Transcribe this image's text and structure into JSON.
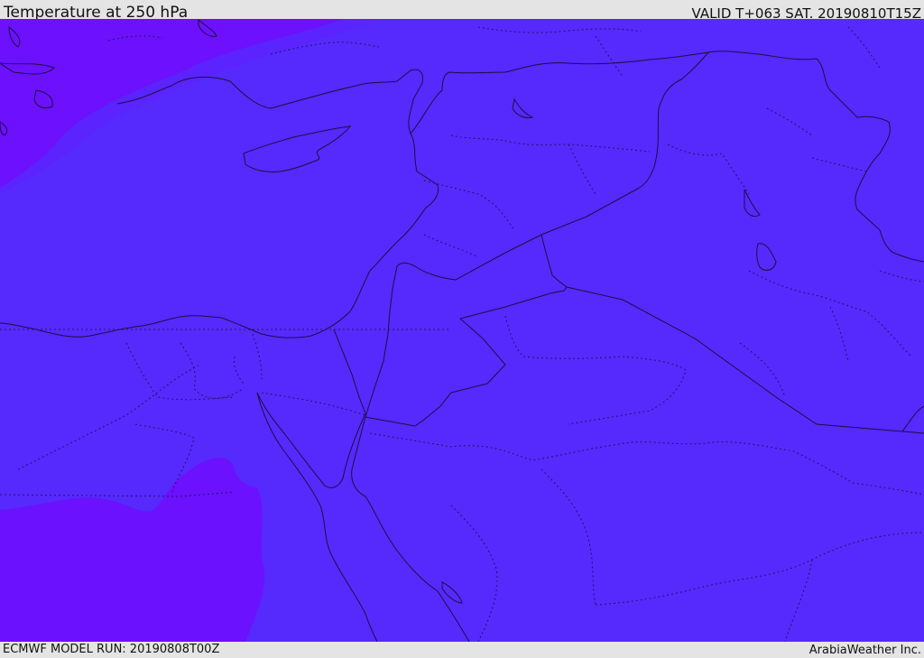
{
  "header": {
    "title": "Temperature at 250 hPa",
    "valid_time": "VALID T+063 SAT. 20190810T15Z"
  },
  "footer": {
    "model_run": "ECMWF MODEL RUN: 20190808T00Z",
    "credit": "ArabiaWeather Inc."
  },
  "colors": {
    "field_main": "#5629fd",
    "field_cold": "#6a12fd",
    "coastline": "#1a1040",
    "border_dotted": "#221560",
    "frame_bg": "#e4e4e4"
  }
}
